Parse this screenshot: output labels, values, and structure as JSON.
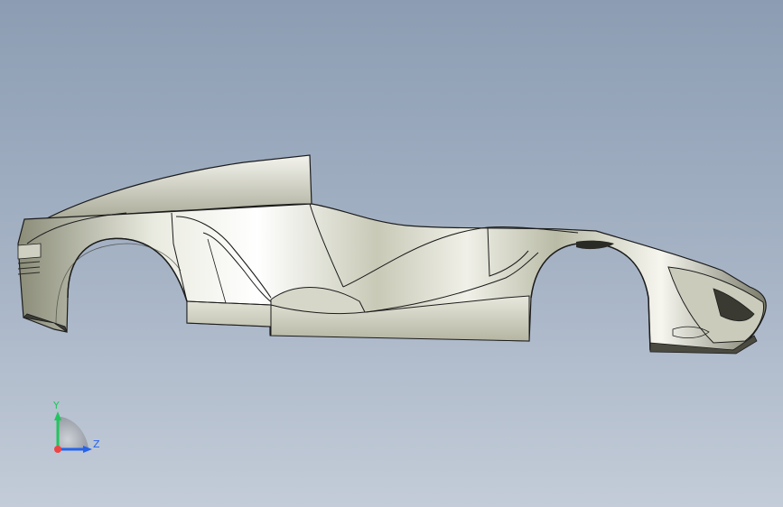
{
  "viewport": {
    "background_top": "#8c9db3",
    "background_bottom": "#c3ccd8"
  },
  "model": {
    "name": "car-body-shell",
    "surface_color": "#e8e7dd",
    "edge_color": "#1c1c1c"
  },
  "triad": {
    "y_label": "Y",
    "z_label": "Z",
    "y_color": "#22c55e",
    "z_color": "#2563eb",
    "x_color": "#ef4444"
  }
}
